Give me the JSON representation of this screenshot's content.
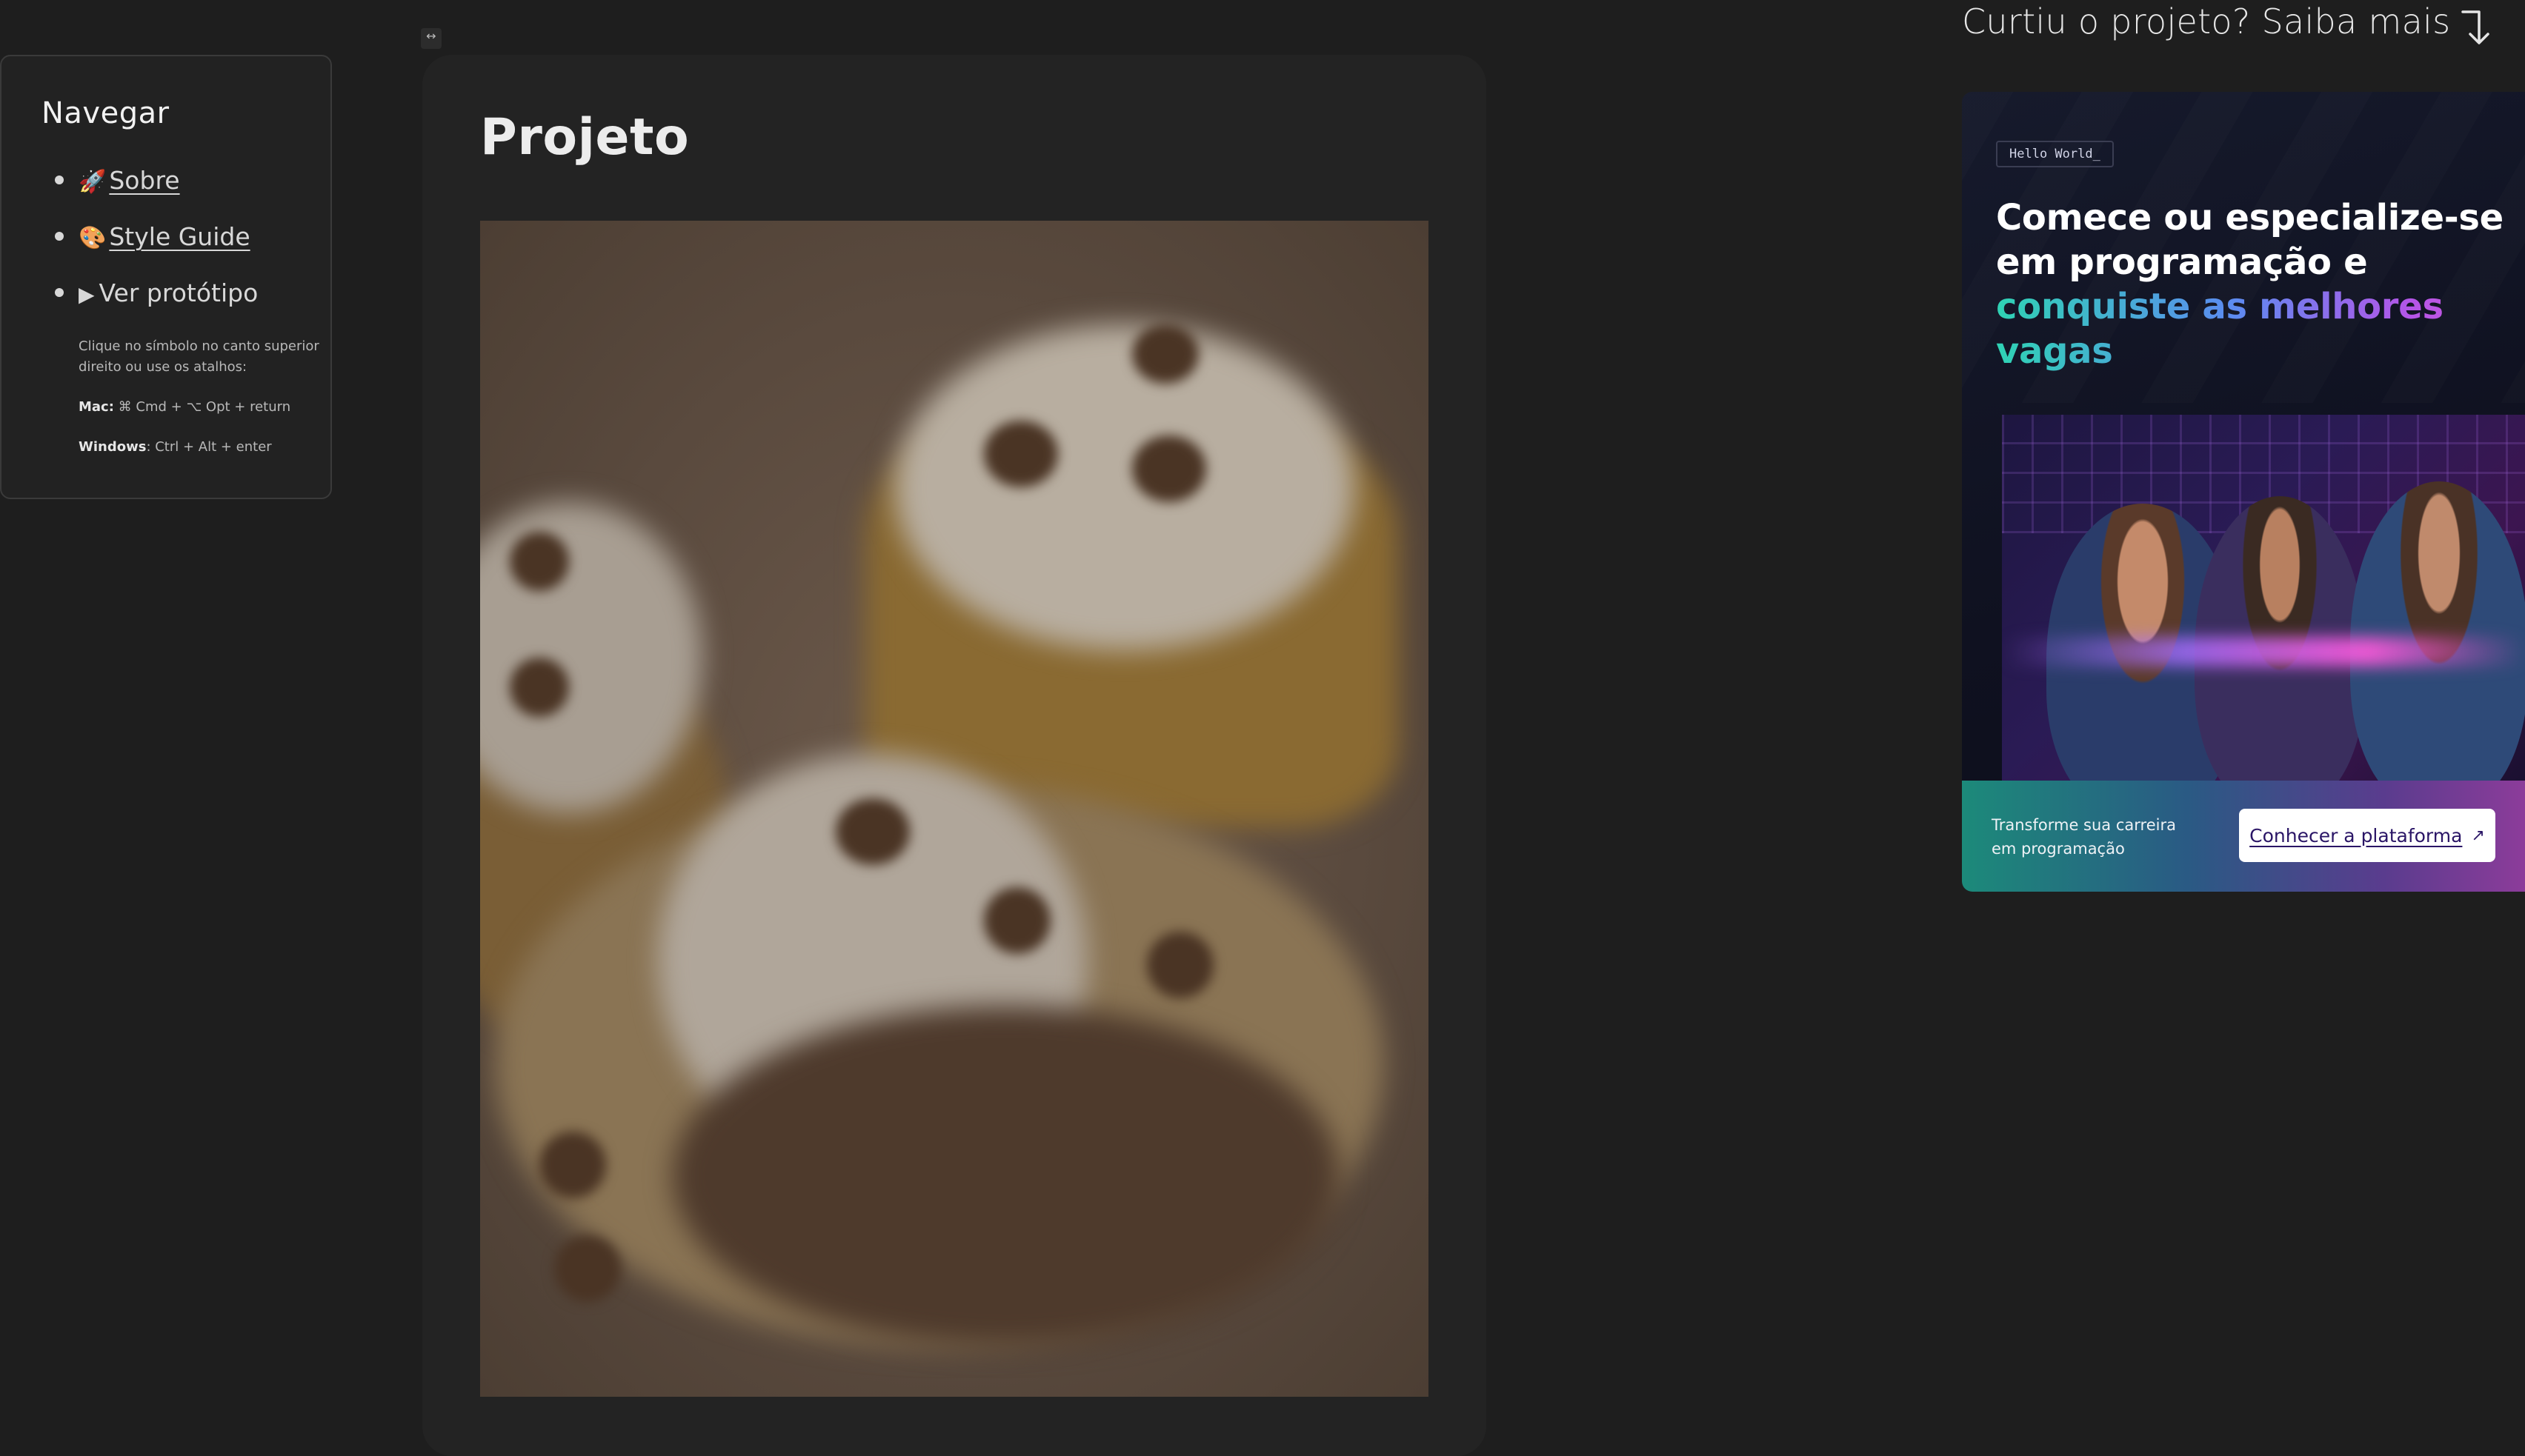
{
  "sidebar": {
    "title": "Navegar",
    "items": [
      {
        "icon": "rocket-icon",
        "emoji": "🚀",
        "label": "Sobre"
      },
      {
        "icon": "palette-icon",
        "emoji": "🎨",
        "label": "Style Guide"
      },
      {
        "icon": "play-icon",
        "emoji": "▶",
        "label": "Ver protótipo"
      }
    ],
    "help": {
      "intro": "Clique no símbolo no canto superior direito ou use os atalhos:",
      "mac_label": "Mac:",
      "mac_keys": "⌘ Cmd + ⌥ Opt + return",
      "windows_label": "Windows",
      "windows_keys": ": Ctrl + Alt + enter"
    }
  },
  "toggle": {
    "icon": "collapse-icon",
    "glyph": "↔"
  },
  "project": {
    "title": "Projeto",
    "image_subject": "blurred cupcakes with chocolate chips"
  },
  "promo": {
    "heading": "Curtiu o projeto? Saiba mais",
    "arrow_icon": "arrow-down-right-icon",
    "tag": "Hello World_",
    "headline_line1": "Comece ou especialize-se",
    "headline_line2": "em programação e",
    "headline_highlight": "conquiste as melhores vagas",
    "footer_text": "Transforme sua carreira em programação",
    "button_label": "Conhecer a plataforma",
    "button_icon": "external-link-icon"
  },
  "colors": {
    "background": "#1e1e1e",
    "card": "#232323",
    "accent_gradient": [
      "#2fd3b4",
      "#5b8cf0",
      "#b455e8",
      "#d25ad6"
    ],
    "button_text": "#2a1566"
  }
}
